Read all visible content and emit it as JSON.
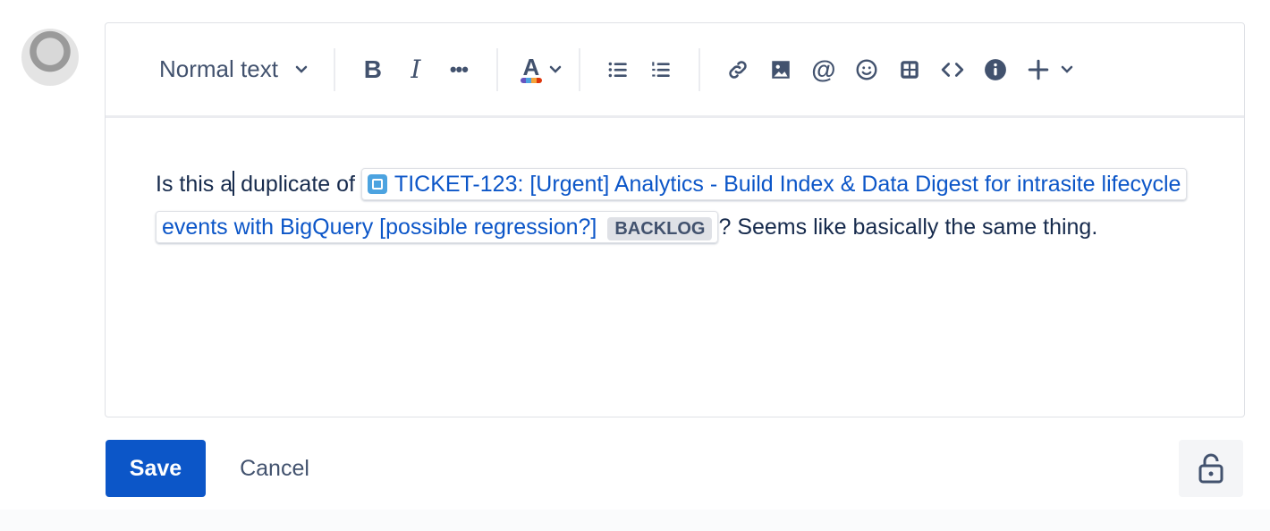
{
  "toolbar": {
    "text_style": "Normal text",
    "icons": [
      "bold-icon",
      "italic-icon",
      "more-formatting-icon",
      "text-color-icon",
      "bullet-list-icon",
      "numbered-list-icon",
      "link-icon",
      "image-icon",
      "mention-icon",
      "emoji-icon",
      "table-icon",
      "code-icon",
      "info-icon",
      "insert-plus-icon"
    ]
  },
  "content": {
    "before": "Is this a",
    "before2": " duplicate of ",
    "card_title": "TICKET-123: [Urgent] Analytics - Build Index & Data Digest for intrasite lifecycle events with BigQuery [possible regression?]",
    "card_status": "BACKLOG",
    "after": "? Seems like basically the same thing."
  },
  "actions": {
    "save": "Save",
    "cancel": "Cancel"
  },
  "colors": {
    "primary": "#0c56c8",
    "icon": "#42526e"
  }
}
